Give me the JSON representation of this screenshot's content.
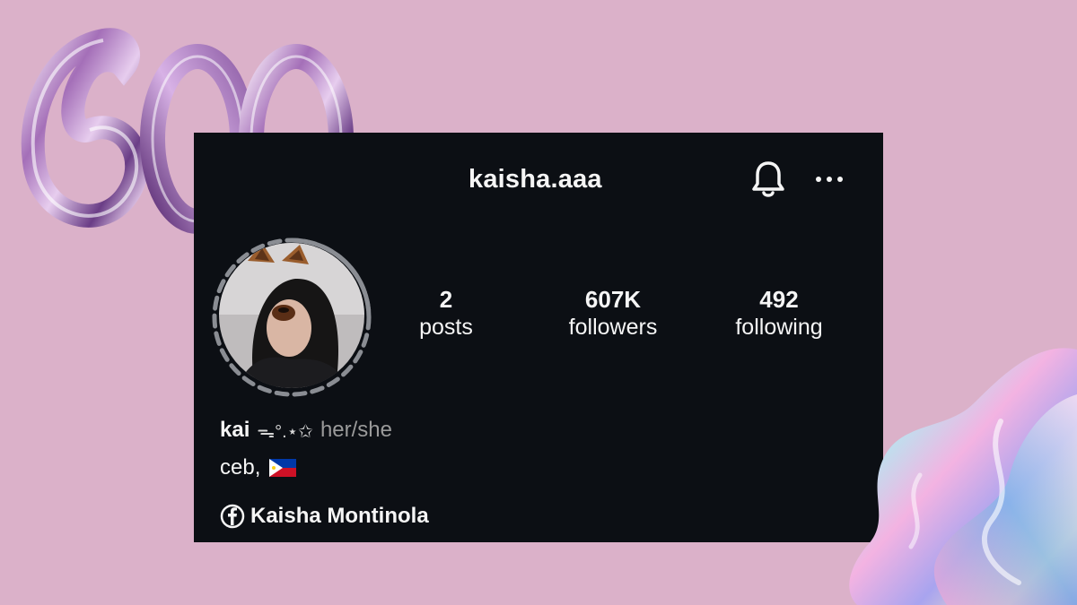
{
  "decoration": {
    "milestone_text": "600K"
  },
  "profile": {
    "username": "kaisha.aaa",
    "stats": {
      "posts": {
        "count": "2",
        "label": "posts"
      },
      "followers": {
        "count": "607K",
        "label": "followers"
      },
      "following": {
        "count": "492",
        "label": "following"
      }
    },
    "bio": {
      "name": "kai",
      "decoration": "ᯓ°.⋆✩",
      "pronouns": "her/she",
      "location": "ceb,",
      "location_flag": "philippines-flag-icon"
    },
    "facebook_link": "Kaisha Montinola"
  },
  "icons": {
    "notifications": "bell-icon",
    "more": "more-options-icon",
    "facebook": "facebook-icon"
  },
  "colors": {
    "background": "#dbb1c9",
    "card": "#0c0f14",
    "text": "#f5f5f5",
    "muted": "#9a9a9a"
  }
}
